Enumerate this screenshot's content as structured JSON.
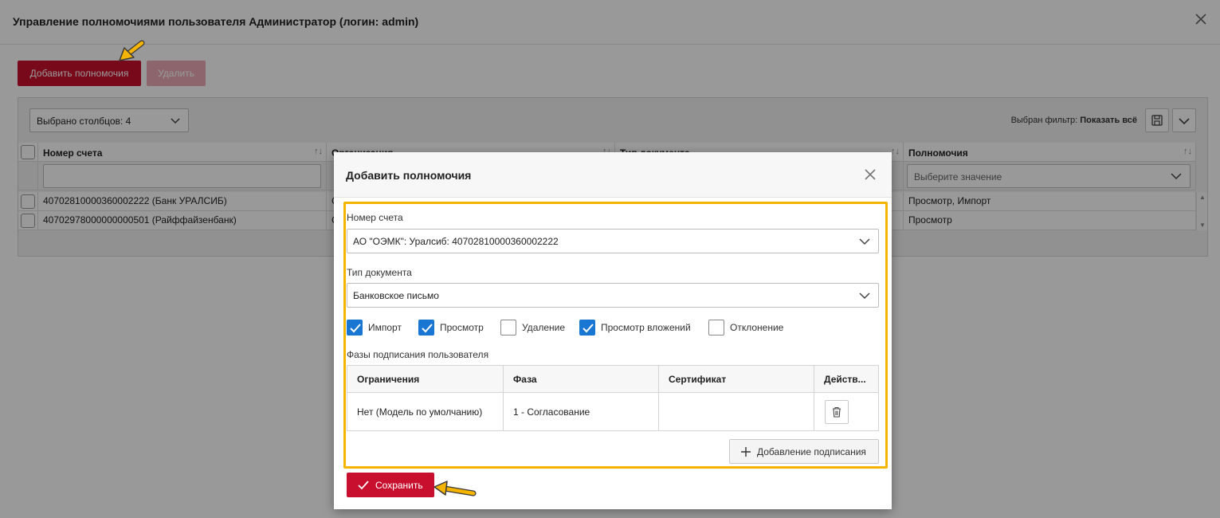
{
  "window": {
    "title": "Управление полномочиями пользователя Администратор (логин: admin)",
    "add_button": "Добавить полномочия",
    "delete_button": "Удалить"
  },
  "grid": {
    "columns_select": "Выбрано столбцов: 4",
    "filter_label": "Выбран фильтр:",
    "filter_value": "Показать всё",
    "headers": [
      "Номер счета",
      "Организация",
      "Тип документа",
      "Полномочия"
    ],
    "permissions_filter_placeholder": "Выберите значение",
    "rows": [
      {
        "account": "40702810000360002222 (Банк УРАЛСИБ)",
        "org": "С",
        "permissions": "Просмотр, Импорт"
      },
      {
        "account": "40702978000000000501 (Райффайзенбанк)",
        "org": "С",
        "permissions": "Просмотр"
      }
    ]
  },
  "modal": {
    "title": "Добавить полномочия",
    "account_label": "Номер счета",
    "account_value": "АО \"ОЭМК\": Уралсиб: 40702810000360002222",
    "doctype_label": "Тип документа",
    "doctype_value": "Банковское письмо",
    "checkboxes": [
      {
        "label": "Импорт",
        "checked": true
      },
      {
        "label": "Просмотр",
        "checked": true
      },
      {
        "label": "Удаление",
        "checked": false
      },
      {
        "label": "Просмотр вложений",
        "checked": true
      },
      {
        "label": "Отклонение",
        "checked": false
      }
    ],
    "phases_label": "Фазы подписания пользователя",
    "phase_table": {
      "headers": [
        "Ограничения",
        "Фаза",
        "Сертификат",
        "Действ..."
      ],
      "row": {
        "restriction": "Нет (Модель по умолчанию)",
        "phase": "1 - Согласование",
        "certificate": ""
      }
    },
    "add_signing_button": "Добавление подписания",
    "save_button": "Сохранить"
  },
  "colors": {
    "accent_red": "#c8102e",
    "checkbox_blue": "#1976d2",
    "highlight_yellow": "#f5b400"
  }
}
